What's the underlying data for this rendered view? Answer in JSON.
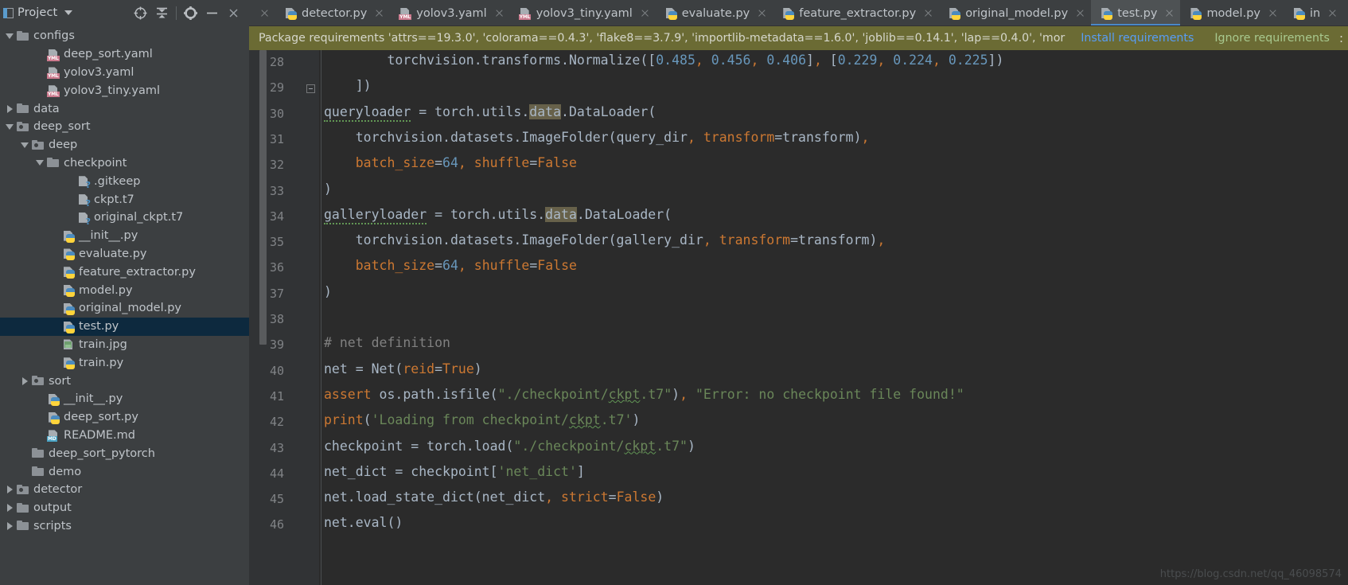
{
  "sidebar": {
    "title": "Project",
    "tools": [
      "locate-icon",
      "collapse-all-icon",
      "settings-gear-icon",
      "minimize-icon"
    ],
    "tree": [
      {
        "label": "configs",
        "type": "folder",
        "depth": 0,
        "twisty": "down"
      },
      {
        "label": "deep_sort.yaml",
        "type": "yaml",
        "depth": 2,
        "twisty": "none"
      },
      {
        "label": "yolov3.yaml",
        "type": "yaml",
        "depth": 2,
        "twisty": "none"
      },
      {
        "label": "yolov3_tiny.yaml",
        "type": "yaml",
        "depth": 2,
        "twisty": "none"
      },
      {
        "label": "data",
        "type": "folder",
        "depth": 0,
        "twisty": "right"
      },
      {
        "label": "deep_sort",
        "type": "folder-module",
        "depth": 0,
        "twisty": "down"
      },
      {
        "label": "deep",
        "type": "folder-module",
        "depth": 1,
        "twisty": "down"
      },
      {
        "label": "checkpoint",
        "type": "folder",
        "depth": 2,
        "twisty": "down"
      },
      {
        "label": ".gitkeep",
        "type": "unknown",
        "depth": 4,
        "twisty": "none"
      },
      {
        "label": "ckpt.t7",
        "type": "unknown",
        "depth": 4,
        "twisty": "none"
      },
      {
        "label": "original_ckpt.t7",
        "type": "unknown",
        "depth": 4,
        "twisty": "none"
      },
      {
        "label": "__init__.py",
        "type": "python",
        "depth": 3,
        "twisty": "none"
      },
      {
        "label": "evaluate.py",
        "type": "python",
        "depth": 3,
        "twisty": "none"
      },
      {
        "label": "feature_extractor.py",
        "type": "python",
        "depth": 3,
        "twisty": "none"
      },
      {
        "label": "model.py",
        "type": "python",
        "depth": 3,
        "twisty": "none"
      },
      {
        "label": "original_model.py",
        "type": "python",
        "depth": 3,
        "twisty": "none"
      },
      {
        "label": "test.py",
        "type": "python",
        "depth": 3,
        "twisty": "none",
        "selected": true
      },
      {
        "label": "train.jpg",
        "type": "image",
        "depth": 3,
        "twisty": "none"
      },
      {
        "label": "train.py",
        "type": "python",
        "depth": 3,
        "twisty": "none"
      },
      {
        "label": "sort",
        "type": "folder-module",
        "depth": 1,
        "twisty": "right"
      },
      {
        "label": "__init__.py",
        "type": "python",
        "depth": 2,
        "twisty": "none"
      },
      {
        "label": "deep_sort.py",
        "type": "python",
        "depth": 2,
        "twisty": "none"
      },
      {
        "label": "README.md",
        "type": "markdown",
        "depth": 2,
        "twisty": "none"
      },
      {
        "label": "deep_sort_pytorch",
        "type": "folder",
        "depth": 1,
        "twisty": "none"
      },
      {
        "label": "demo",
        "type": "folder",
        "depth": 1,
        "twisty": "none"
      },
      {
        "label": "detector",
        "type": "folder-module",
        "depth": 0,
        "twisty": "right"
      },
      {
        "label": "output",
        "type": "folder",
        "depth": 0,
        "twisty": "right"
      },
      {
        "label": "scripts",
        "type": "folder",
        "depth": 0,
        "twisty": "right"
      }
    ]
  },
  "tabs": [
    {
      "label": "detector.py",
      "type": "python",
      "active": false
    },
    {
      "label": "yolov3.yaml",
      "type": "yaml",
      "active": false
    },
    {
      "label": "yolov3_tiny.yaml",
      "type": "yaml",
      "active": false
    },
    {
      "label": "evaluate.py",
      "type": "python",
      "active": false
    },
    {
      "label": "feature_extractor.py",
      "type": "python",
      "active": false
    },
    {
      "label": "original_model.py",
      "type": "python",
      "active": false
    },
    {
      "label": "test.py",
      "type": "python",
      "active": true
    },
    {
      "label": "model.py",
      "type": "python",
      "active": false
    },
    {
      "label": "in",
      "type": "python",
      "active": false
    }
  ],
  "notification": {
    "message": "Package requirements 'attrs==19.3.0', 'colorama==0.4.3', 'flake8==3.7.9', 'importlib-metadata==1.6.0', 'joblib==0.14.1', 'lap==0.4.0', 'mor",
    "install_label": "Install requirements",
    "ignore_label": "Ignore requirements",
    "more_label": ":",
    "bg_color": "#6b6b34",
    "link_color": "#589df6"
  },
  "editor": {
    "first_line": 28,
    "last_line": 46,
    "line_numbers": [
      28,
      29,
      30,
      31,
      32,
      33,
      34,
      35,
      36,
      37,
      38,
      39,
      40,
      41,
      42,
      43,
      44,
      45,
      46
    ],
    "lines": [
      "        torchvision.transforms.Normalize([0.485, 0.456, 0.406], [0.229, 0.224, 0.225])",
      "    ])",
      "queryloader = torch.utils.data.DataLoader(",
      "    torchvision.datasets.ImageFolder(query_dir, transform=transform),",
      "    batch_size=64, shuffle=False",
      ")",
      "galleryloader = torch.utils.data.DataLoader(",
      "    torchvision.datasets.ImageFolder(gallery_dir, transform=transform),",
      "    batch_size=64, shuffle=False",
      ")",
      "",
      "# net definition",
      "net = Net(reid=True)",
      "assert os.path.isfile(\"./checkpoint/ckpt.t7\"), \"Error: no checkpoint file found!\"",
      "print('Loading from checkpoint/ckpt.t7')",
      "checkpoint = torch.load(\"./checkpoint/ckpt.t7\")",
      "net_dict = checkpoint['net_dict']",
      "net.load_state_dict(net_dict, strict=False)",
      "net.eval()"
    ],
    "colors": {
      "background": "#2b2b2b",
      "gutter": "#313335",
      "text": "#a9b7c6",
      "keyword": "#cc7832",
      "number": "#6897bb",
      "string": "#6a8759",
      "comment": "#808080",
      "highlight": "#67614a"
    }
  },
  "watermark": "https://blog.csdn.net/qq_46098574"
}
